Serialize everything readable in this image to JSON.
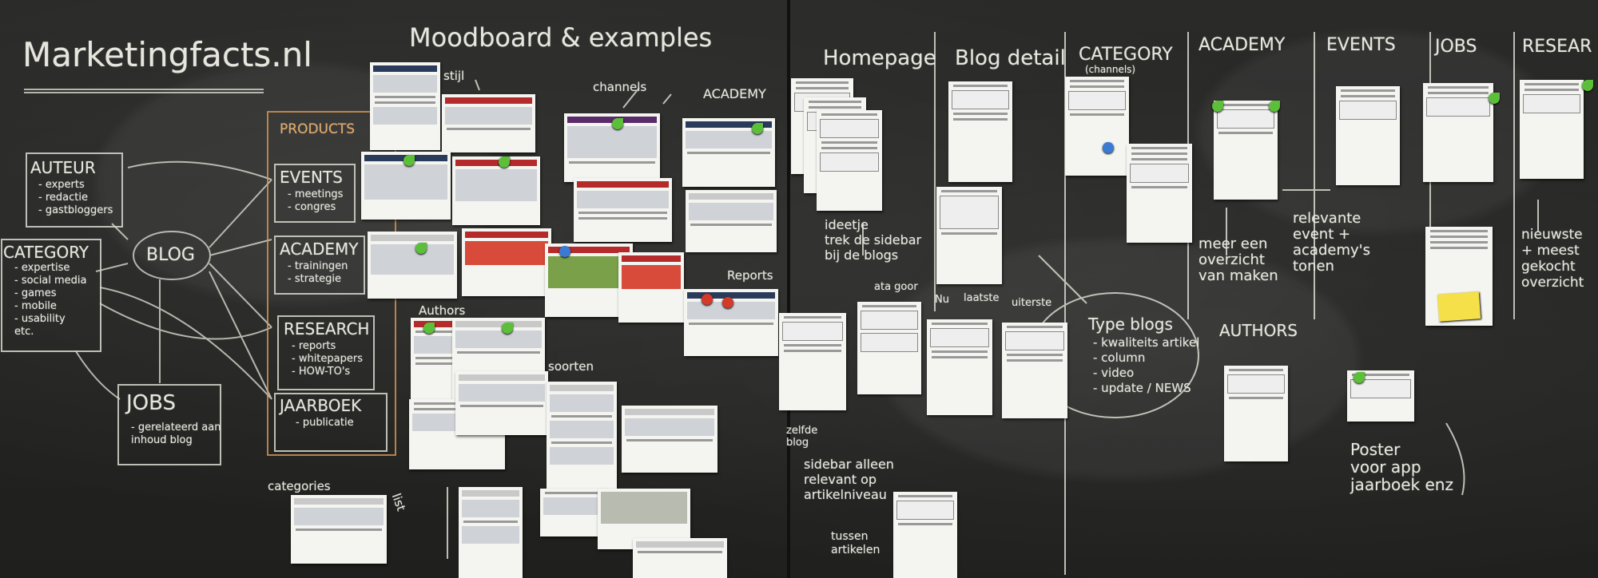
{
  "board": {
    "title": "Marketingfacts.nl",
    "moodboard_heading": "Moodboard & examples",
    "moodboard_labels": {
      "stijl": "stijl",
      "channels": "channels",
      "academy": "ACADEMY",
      "reports": "Reports",
      "authors": "Authors",
      "soorten": "soorten",
      "categories": "categories",
      "list": "list"
    },
    "diagram": {
      "center": "BLOG",
      "auteur": {
        "title": "AUTEUR",
        "items": [
          "- experts",
          "- redactie",
          "- gastbloggers"
        ]
      },
      "category": {
        "title": "CATEGORY",
        "items": [
          "- expertise",
          "- social media",
          "- games",
          "- mobile",
          "- usability",
          "etc."
        ]
      },
      "jobs": {
        "title": "JOBS",
        "items": [
          "- gerelateerd aan",
          "inhoud blog"
        ]
      },
      "products_label": "PRODUCTS",
      "events": {
        "title": "EVENTS",
        "items": [
          "- meetings",
          "- congres"
        ]
      },
      "academy": {
        "title": "ACADEMY",
        "items": [
          "- trainingen",
          "- strategie"
        ]
      },
      "research": {
        "title": "RESEARCH",
        "items": [
          "- reports",
          "- whitepapers",
          "- HOW-TO's"
        ]
      },
      "jaarboek": {
        "title": "JAARBOEK",
        "items": [
          "- publicatie"
        ]
      }
    },
    "sections": [
      "Homepage",
      "Blog detail",
      "CATEGORY",
      "ACADEMY",
      "EVENTS",
      "JOBS",
      "RESEAR"
    ],
    "category_sub": "(channels)",
    "notes": {
      "ideetje": [
        "ideetje",
        "trek de sidebar",
        "bij de blogs"
      ],
      "atagoor": "ata goor",
      "nu": "Nu",
      "laatste": "laatste",
      "uiterste": "uiterste",
      "type_blogs": {
        "title": "Type blogs",
        "items": [
          "- kwaliteits artikel",
          "- column",
          "- video",
          "- update / NEWS"
        ]
      },
      "academy_note": [
        "meer een",
        "overzicht",
        "van maken"
      ],
      "events_note": [
        "relevante",
        "event +",
        "academy's",
        "tonen"
      ],
      "research_note": [
        "nieuwste",
        "+ meest",
        "gekocht",
        "overzicht"
      ],
      "authors": "AUTHORS",
      "poster": [
        "Poster",
        "voor app",
        "jaarboek enz"
      ],
      "zelfde_blog": [
        "zelfde",
        "blog"
      ],
      "sidebar": [
        "sidebar alleen",
        "relevant op",
        "artikelniveau"
      ],
      "tussen": [
        "tussen",
        "artikelen"
      ]
    }
  }
}
